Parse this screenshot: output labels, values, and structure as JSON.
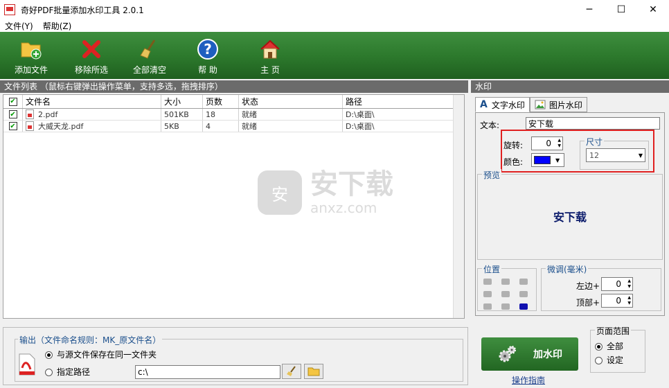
{
  "window": {
    "title": "奇好PDF批量添加水印工具 2.0.1",
    "minimize": "─",
    "maximize": "☐",
    "close": "✕"
  },
  "menu": [
    "文件(Y)",
    "帮助(Z)"
  ],
  "toolbar": [
    {
      "label": "添加文件",
      "icon": "add-folder-icon"
    },
    {
      "label": "移除所选",
      "icon": "red-x-icon"
    },
    {
      "label": "全部清空",
      "icon": "broom-icon"
    },
    {
      "label": "帮 助",
      "icon": "help-icon"
    },
    {
      "label": "主 页",
      "icon": "home-icon"
    }
  ],
  "filelist": {
    "header": "文件列表 （鼠标右键弹出操作菜单，支持多选，拖拽排序）",
    "columns": [
      "文件名",
      "大小",
      "页数",
      "状态",
      "路径"
    ],
    "rows": [
      {
        "name": "2.pdf",
        "size": "501KB",
        "pages": "18",
        "status": "就绪",
        "path": "D:\\桌面\\"
      },
      {
        "name": "大威天龙.pdf",
        "size": "5KB",
        "pages": "4",
        "status": "就绪",
        "path": "D:\\桌面\\"
      }
    ]
  },
  "output": {
    "label": "输出（文件命名规则：MK_原文件名）",
    "option_same": "与源文件保存在同一文件夹",
    "option_path": "指定路径",
    "path_value": "c:\\"
  },
  "watermark": {
    "header": "水印",
    "tab_text": "文字水印",
    "tab_image": "图片水印",
    "text_label": "文本:",
    "text_value": "安下载",
    "rotate_label": "旋转:",
    "rotate_value": "0",
    "color_label": "颜色:",
    "color_value": "#0000ff",
    "size_label": "尺寸",
    "size_value": "12",
    "preview_label": "预览",
    "preview_text": "安下载",
    "position_label": "位置",
    "adjust_label": "微调(毫米)",
    "left_label": "左边+",
    "left_value": "0",
    "top_label": "顶部+",
    "top_value": "0"
  },
  "run": {
    "button": "加水印",
    "guide": "操作指南",
    "range_label": "页面范围",
    "range_all": "全部",
    "range_custom": "设定"
  },
  "overlay": {
    "cn": "安下载",
    "en": "anxz.com",
    "glyph": "安"
  }
}
